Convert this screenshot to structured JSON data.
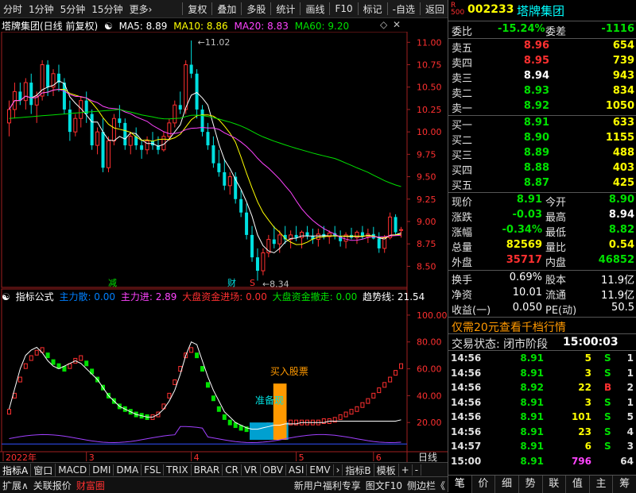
{
  "toolbar": {
    "left": [
      "分时",
      "1分钟",
      "5分钟",
      "15分钟",
      "更多›"
    ],
    "right": [
      "复权",
      "叠加",
      "多股",
      "统计",
      "画线",
      "F10",
      "标记",
      "-自选",
      "返回"
    ]
  },
  "kline": {
    "title": "塔牌集团(日线 前复权)",
    "ma5": "MA5: 8.89",
    "ma10": "MA10: 8.86",
    "ma20": "MA20: 8.83",
    "ma60": "MA60: 9.20",
    "high_label": "11.02",
    "low_label": "8.34",
    "mark_jian": "减",
    "mark_cai": "财",
    "mark_s": "S",
    "y_ticks": [
      "11.00",
      "10.75",
      "10.50",
      "10.25",
      "10.00",
      "9.75",
      "9.50",
      "9.25",
      "9.00",
      "8.75",
      "8.50"
    ]
  },
  "indicator": {
    "formula_label": "指标公式",
    "main_out": "主力散: 0.00",
    "main_in": "主力进: 2.89",
    "big_in": "大盘资金进场: 0.00",
    "big_out": "大盘资金撤走: 0.00",
    "trend": "趋势线: 21.54",
    "buy_label": "买入股票",
    "prepare_label": "准备现",
    "y_ticks": [
      "100.00",
      "80.00",
      "60.00",
      "40.00",
      "20.00"
    ]
  },
  "x_axis": [
    "2022年",
    "3",
    "4",
    "5",
    "6"
  ],
  "x_axis_right": "日线",
  "bottom_tabs": [
    "指标A",
    "窗口",
    "MACD",
    "DMI",
    "DMA",
    "FSL",
    "TRIX",
    "BRAR",
    "CR",
    "VR",
    "OBV",
    "ASI",
    "EMV",
    "›",
    "指标B",
    "模板",
    "+",
    "-"
  ],
  "status_bar": {
    "left": [
      "扩展∧",
      "关联报价",
      "财富圈"
    ],
    "right": [
      "新用户福利专享",
      "图文F10",
      "侧边栏《"
    ]
  },
  "quote": {
    "r_badge": "R",
    "r_num": "500",
    "code": "002233",
    "name": "塔牌集团",
    "weibi_label": "委比",
    "weibi": "-15.24%",
    "weicha_label": "委差",
    "weicha": "-1116",
    "asks": [
      {
        "label": "卖五",
        "price": "8.96",
        "vol": "654",
        "color": "#ff3030"
      },
      {
        "label": "卖四",
        "price": "8.95",
        "vol": "739",
        "color": "#ff3030"
      },
      {
        "label": "卖三",
        "price": "8.94",
        "vol": "943",
        "color": "#ffffff"
      },
      {
        "label": "卖二",
        "price": "8.93",
        "vol": "834",
        "color": "#00e000"
      },
      {
        "label": "卖一",
        "price": "8.92",
        "vol": "1050",
        "color": "#00e000"
      }
    ],
    "bids": [
      {
        "label": "买一",
        "price": "8.91",
        "vol": "633",
        "color": "#00e000"
      },
      {
        "label": "买二",
        "price": "8.90",
        "vol": "1155",
        "color": "#00e000"
      },
      {
        "label": "买三",
        "price": "8.89",
        "vol": "488",
        "color": "#00e000"
      },
      {
        "label": "买四",
        "price": "8.88",
        "vol": "403",
        "color": "#00e000"
      },
      {
        "label": "买五",
        "price": "8.87",
        "vol": "425",
        "color": "#00e000"
      }
    ],
    "stats": [
      {
        "l1": "现价",
        "v1": "8.91",
        "c1": "#00e000",
        "l2": "今开",
        "v2": "8.90",
        "c2": "#00e000"
      },
      {
        "l1": "涨跌",
        "v1": "-0.03",
        "c1": "#00e000",
        "l2": "最高",
        "v2": "8.94",
        "c2": "#ffffff"
      },
      {
        "l1": "涨幅",
        "v1": "-0.34%",
        "c1": "#00e000",
        "l2": "最低",
        "v2": "8.82",
        "c2": "#00e000"
      },
      {
        "l1": "总量",
        "v1": "82569",
        "c1": "#ffff00",
        "l2": "量比",
        "v2": "0.54",
        "c2": "#ffff00"
      },
      {
        "l1": "外盘",
        "v1": "35717",
        "c1": "#ff3030",
        "l2": "内盘",
        "v2": "46852",
        "c2": "#00e000"
      }
    ],
    "stats2": [
      {
        "l1": "换手",
        "v1": "0.69%",
        "l2": "股本",
        "v2": "11.9亿"
      },
      {
        "l1": "净资",
        "v1": "10.01",
        "l2": "流通",
        "v2": "11.9亿"
      },
      {
        "l1": "收益(一)",
        "v1": "0.050",
        "l2": "PE(动)",
        "v2": "50.5"
      }
    ],
    "promo": "仅需20元查看千档行情",
    "trade_status": "交易状态: 闭市阶段",
    "trade_time": "15:00:03",
    "ticks": [
      {
        "t": "14:56",
        "p": "8.91",
        "v": "5",
        "d": "S",
        "n": "1",
        "vc": "#ffff00",
        "dc": "#00e000"
      },
      {
        "t": "14:56",
        "p": "8.91",
        "v": "3",
        "d": "S",
        "n": "1",
        "vc": "#ffff00",
        "dc": "#00e000"
      },
      {
        "t": "14:56",
        "p": "8.92",
        "v": "22",
        "d": "B",
        "n": "2",
        "vc": "#ffff00",
        "dc": "#ff3030"
      },
      {
        "t": "14:56",
        "p": "8.91",
        "v": "3",
        "d": "S",
        "n": "1",
        "vc": "#ffff00",
        "dc": "#00e000"
      },
      {
        "t": "14:56",
        "p": "8.91",
        "v": "101",
        "d": "S",
        "n": "5",
        "vc": "#ffff00",
        "dc": "#00e000"
      },
      {
        "t": "14:56",
        "p": "8.91",
        "v": "23",
        "d": "S",
        "n": "4",
        "vc": "#ffff00",
        "dc": "#00e000"
      },
      {
        "t": "14:57",
        "p": "8.91",
        "v": "6",
        "d": "S",
        "n": "3",
        "vc": "#ffff00",
        "dc": "#00e000"
      },
      {
        "t": "15:00",
        "p": "8.91",
        "v": "796",
        "d": "",
        "n": "64",
        "vc": "#ff44ff",
        "dc": "#00e000"
      }
    ],
    "tabs": [
      "笔",
      "价",
      "细",
      "势",
      "联",
      "值",
      "主",
      "筹"
    ]
  },
  "chart_data": [
    {
      "type": "candlestick",
      "title": "塔牌集团(日线 前复权)",
      "ylim": [
        8.3,
        11.1
      ],
      "y_ticks": [
        8.5,
        8.75,
        9.0,
        9.25,
        9.5,
        9.75,
        10.0,
        10.25,
        10.5,
        10.75,
        11.0
      ],
      "x_month_labels": [
        "2022年",
        "3",
        "4",
        "5",
        "6"
      ],
      "ohlc": [
        [
          10.1,
          10.35,
          9.95,
          10.25
        ],
        [
          10.25,
          10.55,
          10.15,
          10.45
        ],
        [
          10.45,
          10.55,
          10.3,
          10.35
        ],
        [
          10.35,
          10.6,
          10.25,
          10.55
        ],
        [
          10.55,
          10.65,
          10.2,
          10.3
        ],
        [
          10.3,
          10.45,
          10.1,
          10.4
        ],
        [
          10.4,
          10.8,
          10.35,
          10.75
        ],
        [
          10.75,
          10.8,
          10.4,
          10.5
        ],
        [
          10.5,
          10.7,
          10.4,
          10.65
        ],
        [
          10.65,
          10.75,
          10.45,
          10.55
        ],
        [
          10.55,
          10.6,
          10.2,
          10.25
        ],
        [
          10.25,
          10.35,
          9.9,
          10.0
        ],
        [
          10.0,
          10.2,
          9.95,
          10.15
        ],
        [
          10.15,
          10.4,
          10.05,
          10.35
        ],
        [
          10.35,
          10.45,
          10.1,
          10.2
        ],
        [
          10.2,
          10.25,
          9.8,
          9.85
        ],
        [
          9.85,
          10.05,
          9.75,
          10.0
        ],
        [
          10.0,
          10.15,
          9.55,
          9.6
        ],
        [
          9.6,
          9.95,
          9.55,
          9.9
        ],
        [
          9.9,
          10.2,
          9.85,
          10.15
        ],
        [
          10.15,
          10.3,
          10.05,
          10.1
        ],
        [
          10.1,
          10.15,
          9.8,
          9.85
        ],
        [
          9.85,
          10.0,
          9.75,
          9.95
        ],
        [
          9.95,
          10.05,
          9.8,
          9.85
        ],
        [
          9.85,
          9.9,
          9.7,
          9.8
        ],
        [
          9.8,
          9.95,
          9.75,
          9.9
        ],
        [
          9.9,
          10.0,
          9.8,
          9.85
        ],
        [
          9.85,
          9.95,
          9.75,
          9.8
        ],
        [
          9.8,
          10.0,
          9.78,
          9.95
        ],
        [
          9.95,
          10.15,
          9.9,
          10.1
        ],
        [
          10.1,
          10.35,
          10.05,
          10.3
        ],
        [
          10.3,
          10.45,
          10.2,
          10.25
        ],
        [
          10.25,
          10.8,
          10.2,
          10.75
        ],
        [
          10.75,
          11.02,
          10.6,
          10.65
        ],
        [
          10.65,
          10.7,
          10.15,
          10.25
        ],
        [
          10.25,
          10.3,
          9.95,
          10.0
        ],
        [
          10.0,
          10.1,
          9.8,
          9.85
        ],
        [
          9.85,
          9.95,
          9.6,
          9.65
        ],
        [
          9.65,
          9.8,
          9.5,
          9.55
        ],
        [
          9.55,
          9.7,
          9.35,
          9.4
        ],
        [
          9.4,
          9.55,
          9.3,
          9.5
        ],
        [
          9.5,
          9.55,
          9.2,
          9.25
        ],
        [
          9.25,
          9.35,
          9.05,
          9.1
        ],
        [
          9.1,
          9.2,
          8.8,
          8.85
        ],
        [
          8.85,
          8.95,
          8.55,
          8.6
        ],
        [
          8.6,
          8.7,
          8.34,
          8.45
        ],
        [
          8.45,
          8.7,
          8.4,
          8.65
        ],
        [
          8.65,
          8.85,
          8.6,
          8.8
        ],
        [
          8.8,
          8.95,
          8.7,
          8.75
        ],
        [
          8.75,
          8.9,
          8.65,
          8.85
        ],
        [
          8.85,
          8.95,
          8.75,
          8.8
        ],
        [
          8.8,
          8.9,
          8.7,
          8.85
        ],
        [
          8.85,
          8.95,
          8.78,
          8.82
        ],
        [
          8.82,
          8.9,
          8.7,
          8.88
        ],
        [
          8.88,
          8.95,
          8.8,
          8.84
        ],
        [
          8.84,
          8.92,
          8.75,
          8.8
        ],
        [
          8.8,
          8.92,
          8.72,
          8.86
        ],
        [
          8.86,
          8.95,
          8.8,
          8.83
        ],
        [
          8.83,
          8.9,
          8.75,
          8.87
        ],
        [
          8.87,
          8.95,
          8.8,
          8.84
        ],
        [
          8.84,
          8.9,
          8.72,
          8.78
        ],
        [
          8.78,
          8.88,
          8.7,
          8.85
        ],
        [
          8.85,
          8.93,
          8.8,
          8.82
        ],
        [
          8.82,
          8.9,
          8.75,
          8.88
        ],
        [
          8.88,
          8.95,
          8.8,
          8.83
        ],
        [
          8.83,
          8.92,
          8.76,
          8.86
        ],
        [
          8.86,
          8.94,
          8.8,
          8.81
        ],
        [
          8.81,
          8.88,
          8.65,
          8.7
        ],
        [
          8.7,
          8.85,
          8.65,
          8.82
        ],
        [
          8.82,
          9.1,
          8.8,
          9.05
        ],
        [
          9.05,
          9.08,
          8.85,
          8.88
        ],
        [
          8.9,
          8.94,
          8.82,
          8.91
        ]
      ],
      "ma5_color": "#ffffff",
      "ma10_color": "#ffff00",
      "ma20_color": "#ff44ff",
      "ma60_color": "#00e000"
    },
    {
      "type": "area",
      "title": "指标公式",
      "ylim": [
        0,
        110
      ],
      "y_ticks": [
        20,
        40,
        60,
        80,
        100
      ],
      "series": [
        {
          "name": "趋势线",
          "color": "#ffffff",
          "values": [
            30,
            45,
            60,
            70,
            74,
            76,
            72,
            66,
            62,
            60,
            62,
            64,
            66,
            64,
            60,
            56,
            52,
            46,
            40,
            36,
            32,
            30,
            28,
            26,
            25,
            24,
            24,
            26,
            30,
            36,
            44,
            56,
            70,
            80,
            78,
            66,
            54,
            44,
            36,
            28,
            24,
            20,
            18,
            16,
            15,
            15,
            16,
            17,
            18,
            18,
            19,
            19,
            19,
            20,
            20,
            20,
            20,
            20,
            21,
            21,
            21,
            21,
            21,
            21,
            21,
            21,
            21,
            21,
            21,
            21,
            21,
            22
          ]
        },
        {
          "name": "主力进",
          "color": "#ff3030",
          "values": [
            28,
            40,
            52,
            62,
            68,
            72,
            74,
            70,
            65,
            62,
            60,
            62,
            66,
            68,
            64,
            58,
            52,
            46,
            40,
            36,
            32,
            30,
            28,
            26,
            25,
            24,
            24,
            26,
            32,
            40,
            50,
            60,
            70,
            74,
            70,
            60,
            48,
            38,
            30,
            24,
            20,
            18,
            16,
            15,
            15,
            16,
            17,
            18,
            18,
            19,
            19,
            20,
            20,
            20,
            20,
            20,
            20,
            21,
            21,
            22,
            24,
            26,
            28,
            30,
            33,
            36,
            40,
            44,
            48,
            52,
            57,
            62
          ]
        }
      ]
    }
  ]
}
